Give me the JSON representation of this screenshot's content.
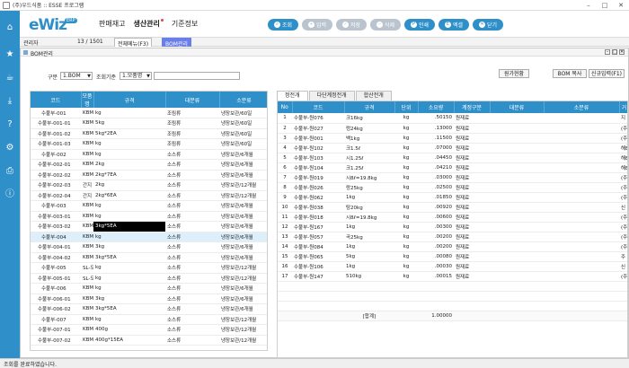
{
  "window": {
    "title": "(주)우드식품 :: ESSE 프로그램",
    "min": "–",
    "max": "□",
    "close": "✕"
  },
  "logo": {
    "text": "eWiz",
    "badge": "ERP"
  },
  "menu": {
    "item1": "판매재고",
    "item2": "생산관리",
    "item3": "기준정보"
  },
  "toolbar": {
    "query": "조회",
    "add": "입력",
    "save": "저장",
    "delete": "삭제",
    "print": "인쇄",
    "excel": "엑셀",
    "close": "닫기"
  },
  "info": {
    "user": "관리자",
    "count": "13 / 1501",
    "tab_all": "전체메뉴(F3)",
    "tab_bom": "BOM관리"
  },
  "mdi": {
    "title": "BOM관리"
  },
  "filter": {
    "type_label": "구분",
    "type_value": "1.BOM",
    "crit_label": "조회기준",
    "crit_value": "1.모품명",
    "btn_raw": "원가현황",
    "btn_copy": "BOM 복사",
    "btn_new": "신규입력(F1)"
  },
  "left_grid": {
    "headers": [
      "코드",
      "모품명",
      "규격",
      "대분류",
      "소분류"
    ],
    "rows": [
      [
        "수불부-001",
        "KBM",
        "kg",
        "조림류",
        "냉장보관/60일"
      ],
      [
        "수불부-001-01",
        "KBM",
        "5kg",
        "조림류",
        "냉장보관/60일"
      ],
      [
        "수불부-001-02",
        "KBM",
        "5kg*2EA",
        "조림류",
        "냉장보관/60일"
      ],
      [
        "수불부-001-03",
        "KBM",
        "kg",
        "조림류",
        "냉장보관/60일"
      ],
      [
        "수불부-002",
        "KBM",
        "kg",
        "소스류",
        "냉장보관/6개월"
      ],
      [
        "수불부-002-01",
        "KBM",
        "2kg",
        "소스류",
        "냉장보관/6개월"
      ],
      [
        "수불부-002-02",
        "KBM",
        "2kg*7EA",
        "소스류",
        "냉장보관/6개월"
      ],
      [
        "수불부-002-03",
        "간지",
        "2kg",
        "소스류",
        "냉장보관/12개월"
      ],
      [
        "수불부-002-04",
        "간지",
        "2kg*6EA",
        "소스류",
        "냉장보관/12개월"
      ],
      [
        "수불부-003",
        "KBM",
        "kg",
        "소스류",
        "냉장보관/6개월"
      ],
      [
        "수불부-003-01",
        "KBM",
        "kg",
        "소스류",
        "냉장보관/6개월"
      ],
      [
        "수불부-003-02",
        "KBM",
        "3kg*5EA",
        "소스류",
        "냉장보관/6개월"
      ],
      [
        "수불부-004",
        "KBM",
        "kg",
        "소스류",
        "냉장보관/6개월"
      ],
      [
        "수불부-004-01",
        "KBM",
        "3kg",
        "소스류",
        "냉장보관/6개월"
      ],
      [
        "수불부-004-02",
        "KBM",
        "3kg*5EA",
        "소스류",
        "냉장보관/6개월"
      ],
      [
        "수불부-005",
        "SL-도",
        "kg",
        "소스류",
        "냉장보관/12개월"
      ],
      [
        "수불부-005-01",
        "SL-도",
        "kg",
        "소스류",
        "냉장보관/12개월"
      ],
      [
        "수불부-006",
        "KBM",
        "kg",
        "소스류",
        "냉장보관/6개월"
      ],
      [
        "수불부-006-01",
        "KBM",
        "3kg",
        "소스류",
        "냉장보관/6개월"
      ],
      [
        "수불부-006-02",
        "KBM",
        "3kg*5EA",
        "소스류",
        "냉장보관/6개월"
      ],
      [
        "수불부-007",
        "KBM",
        "kg",
        "소스류",
        "냉장보관/12개월"
      ],
      [
        "수불부-007-01",
        "KBM",
        "400g",
        "소스류",
        "냉장보관/12개월"
      ],
      [
        "수불부-007-02",
        "KBM",
        "400g*15EA",
        "소스류",
        "냉장보관/12개월"
      ]
    ]
  },
  "right_tabs": {
    "tab1": "정전개",
    "tab2": "다단계정전개",
    "tab3": "합산전개"
  },
  "right_grid": {
    "headers": [
      "No",
      "코드",
      "규격",
      "단위",
      "소요량",
      "계정구분",
      "대분류",
      "소분류",
      "거"
    ],
    "rows": [
      [
        "1",
        "수불부-원076",
        "크16kg",
        "kg",
        ".50150",
        "원재료",
        "",
        "",
        "지"
      ],
      [
        "2",
        "수불부-원027",
        "렁24kg",
        "kg",
        ".13000",
        "원재료",
        "",
        "",
        "(주"
      ],
      [
        "3",
        "수불부-원001",
        "백1kg",
        "kg",
        ".11500",
        "원재료",
        "",
        "",
        "(주"
      ],
      [
        "4",
        "수불부-원102",
        "크1.5ℓ",
        "kg",
        ".07000",
        "원재료",
        "",
        "",
        "해E"
      ],
      [
        "5",
        "수불부-원103",
        "시1.25ℓ",
        "kg",
        ".04450",
        "원재료",
        "",
        "",
        "해E"
      ],
      [
        "6",
        "수불부-원104",
        "크1.25ℓ",
        "kg",
        ".04210",
        "원재료",
        "",
        "",
        "해E"
      ],
      [
        "7",
        "수불부-원019",
        "시8ℓ=19.8kg",
        "kg",
        ".03000",
        "원재료",
        "",
        "",
        "(주"
      ],
      [
        "8",
        "수불부-원026",
        "랑25kg",
        "kg",
        ".02500",
        "원재료",
        "",
        "",
        "(주"
      ],
      [
        "9",
        "수불부-원062",
        "1kg",
        "kg",
        ".01850",
        "원재료",
        "",
        "",
        "(주"
      ],
      [
        "10",
        "수불부-원038",
        "탕20kg",
        "kg",
        ".00920",
        "원재료",
        "",
        "",
        "신"
      ],
      [
        "11",
        "수불부-원018",
        "시8ℓ=19.8kg",
        "kg",
        ".00600",
        "원재료",
        "",
        "",
        "(주"
      ],
      [
        "12",
        "수불부-원167",
        "1kg",
        "kg",
        ".00300",
        "원재료",
        "",
        "",
        "(주"
      ],
      [
        "13",
        "수불부-원057",
        "곡25kg",
        "kg",
        ".00200",
        "원재료",
        "",
        "",
        "(주"
      ],
      [
        "14",
        "수불부-원084",
        "1kg",
        "kg",
        ".00200",
        "원재료",
        "",
        "",
        "(주"
      ],
      [
        "15",
        "수불부-원065",
        "5kg",
        "kg",
        ".00080",
        "원재료",
        "",
        "",
        "주"
      ],
      [
        "16",
        "수불부-원106",
        "1kg",
        "kg",
        ".00030",
        "원재료",
        "",
        "",
        "신"
      ],
      [
        "17",
        "수불부-원147",
        "510kg",
        "kg",
        ".00015",
        "원재료",
        "",
        "",
        "(주"
      ]
    ],
    "total_label": "[합계]",
    "total_value": "1.00000"
  },
  "status": {
    "text": "조회를 완료하였습니다."
  },
  "colors": {
    "accent": "#2e8fc9",
    "selected_tab": "#6a7ee8"
  }
}
